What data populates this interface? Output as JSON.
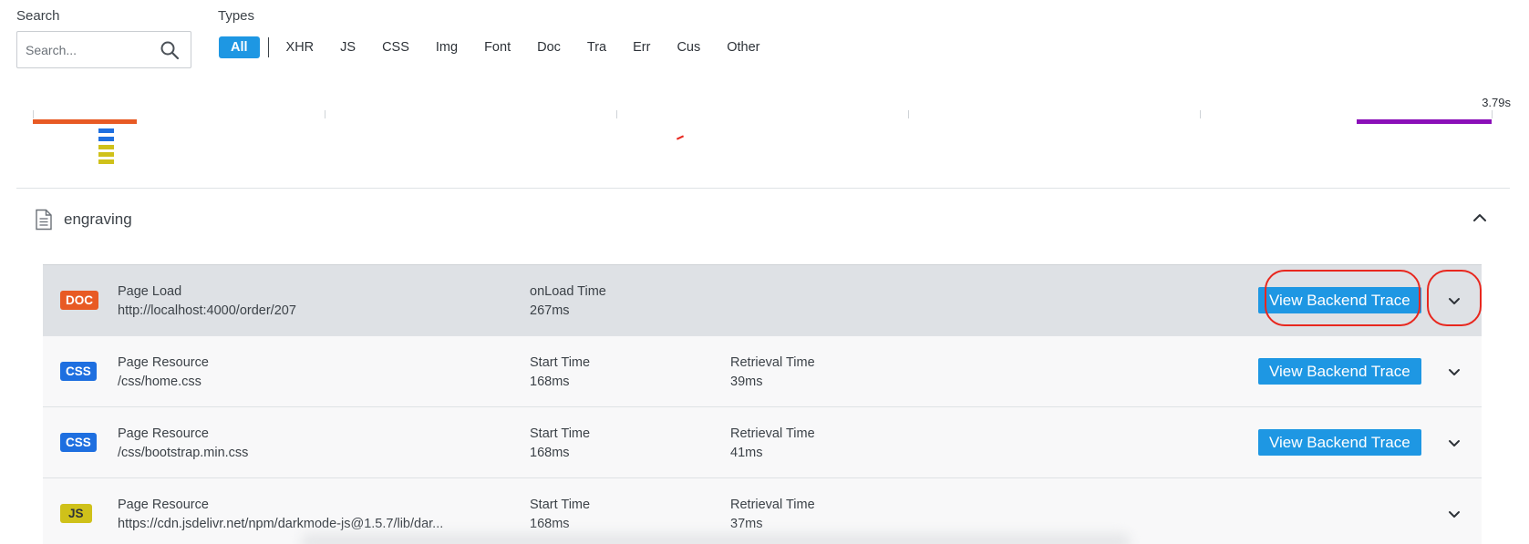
{
  "filters": {
    "search_label": "Search",
    "search_placeholder": "Search...",
    "types_label": "Types",
    "types": [
      "All",
      "XHR",
      "JS",
      "CSS",
      "Img",
      "Font",
      "Doc",
      "Tra",
      "Err",
      "Cus",
      "Other"
    ],
    "active_type": "All"
  },
  "timeline": {
    "end_label": "3.79s"
  },
  "group": {
    "title": "engraving",
    "expanded": true
  },
  "rows": [
    {
      "badge": "DOC",
      "kind": "Page Load",
      "url": "http://localhost:4000/order/207",
      "m1_label": "onLoad Time",
      "m1_value": "267ms",
      "m2_label": "",
      "m2_value": "",
      "action": "View Backend Trace",
      "highlighted": true
    },
    {
      "badge": "CSS",
      "kind": "Page Resource",
      "url": "/css/home.css",
      "m1_label": "Start Time",
      "m1_value": "168ms",
      "m2_label": "Retrieval Time",
      "m2_value": "39ms",
      "action": "View Backend Trace"
    },
    {
      "badge": "CSS",
      "kind": "Page Resource",
      "url": "/css/bootstrap.min.css",
      "m1_label": "Start Time",
      "m1_value": "168ms",
      "m2_label": "Retrieval Time",
      "m2_value": "41ms",
      "action": "View Backend Trace"
    },
    {
      "badge": "JS",
      "kind": "Page Resource",
      "url": "https://cdn.jsdelivr.net/npm/darkmode-js@1.5.7/lib/dar...",
      "m1_label": "Start Time",
      "m1_value": "168ms",
      "m2_label": "Retrieval Time",
      "m2_value": "37ms",
      "action": ""
    }
  ],
  "colors": {
    "accent": "#1e97e3",
    "doc": "#e85a24",
    "css": "#1e6fe0",
    "js": "#cfc11a",
    "annotation": "#e8271e",
    "timeline_purple": "#8a0fb8"
  }
}
